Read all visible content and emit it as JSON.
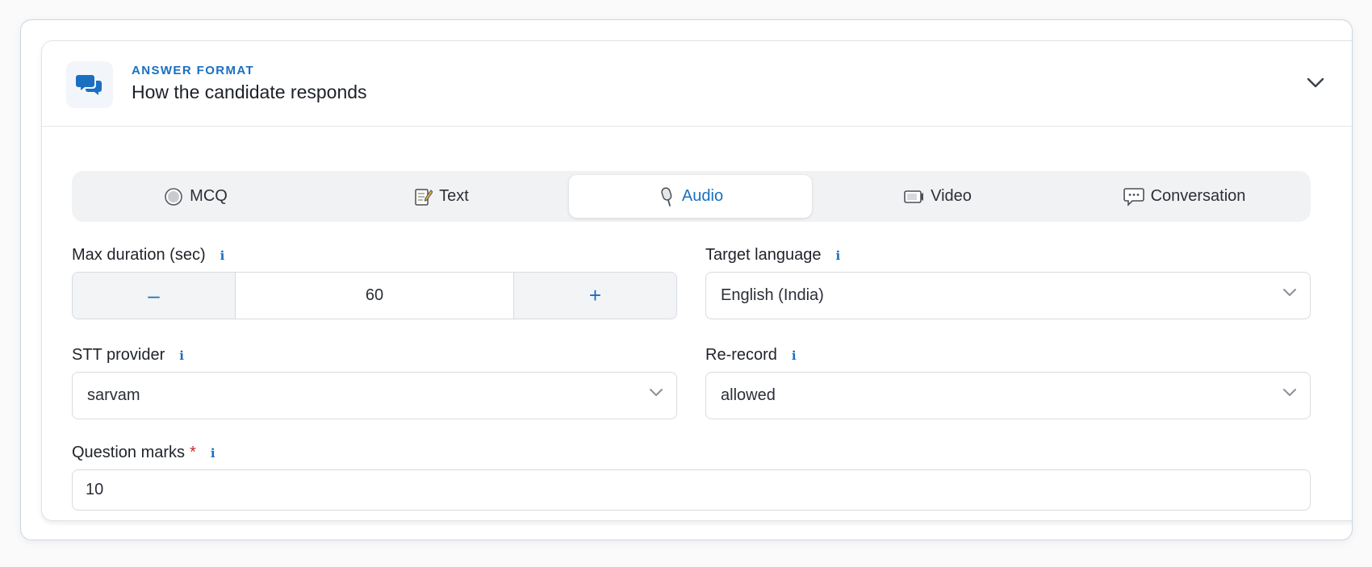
{
  "section": {
    "eyebrow": "ANSWER FORMAT",
    "title": "How the candidate responds",
    "icon": "chat-bubbles-icon",
    "accent_color": "#1a6fc0"
  },
  "tabs": [
    {
      "label": "MCQ",
      "icon": "radio-circle-icon",
      "active": false
    },
    {
      "label": "Text",
      "icon": "memo-icon",
      "active": false
    },
    {
      "label": "Audio",
      "icon": "microphone-icon",
      "active": true
    },
    {
      "label": "Video",
      "icon": "video-camera-icon",
      "active": false
    },
    {
      "label": "Conversation",
      "icon": "speech-bubble-icon",
      "active": false
    }
  ],
  "fields": {
    "max_duration": {
      "label": "Max duration (sec)",
      "value": "60",
      "minus": "–",
      "plus": "+"
    },
    "target_language": {
      "label": "Target language",
      "value": "English (India)"
    },
    "stt_provider": {
      "label": "STT provider",
      "value": "sarvam"
    },
    "re_record": {
      "label": "Re-record",
      "value": "allowed"
    },
    "question_marks": {
      "label": "Question marks",
      "required_mark": "*",
      "value": "10"
    }
  },
  "info_glyph": "i"
}
